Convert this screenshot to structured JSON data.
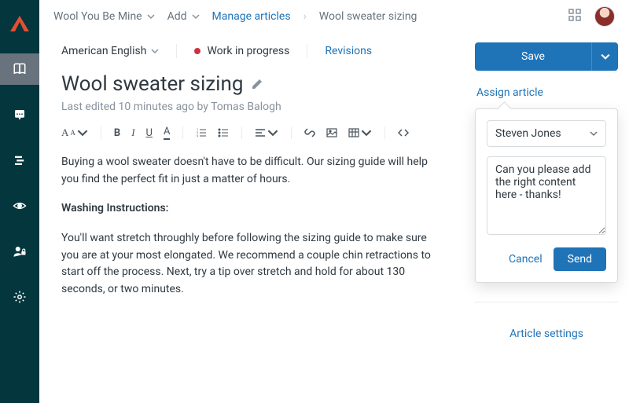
{
  "topbar": {
    "workspace": "Wool You Be Mine",
    "add": "Add",
    "manage": "Manage articles",
    "crumb": "Wool sweater sizing"
  },
  "rail": {
    "items": [
      "book",
      "announce",
      "arrange",
      "eye",
      "user-lock",
      "gear"
    ]
  },
  "editor": {
    "language": "American English",
    "wip": "Work in progress",
    "revisions": "Revisions",
    "title": "Wool sweater sizing",
    "meta": "Last edited 10 minutes ago by Tomas Balogh",
    "body": {
      "p1": "Buying a wool sweater doesn't have to be difficult. Our sizing guide will help you find the perfect fit in just a matter of hours.",
      "h": "Washing Instructions:",
      "p2": "You'll want stretch throughly before following the sizing guide to make sure you are at your most elongated. We recommend a couple chin retractions to start off the process. Next, try a tip over stretch and hold for about 130 seconds, or two minutes."
    },
    "toolbar": {
      "font_size_label": "A",
      "font_size_small": "A"
    }
  },
  "side": {
    "save": "Save",
    "assign": "Assign article",
    "assignee": "Steven Jones",
    "note": "Can you please add the right content here - thanks!",
    "cancel": "Cancel",
    "send": "Send",
    "settings": "Article settings"
  },
  "colors": {
    "accent": "#1F73B7",
    "rail": "#03363D",
    "danger": "#CC3340"
  }
}
